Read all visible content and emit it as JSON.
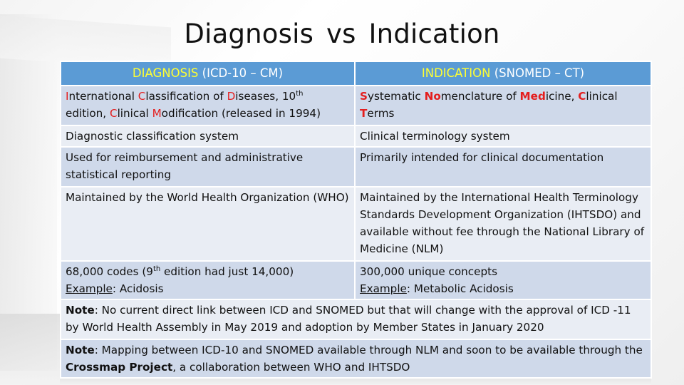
{
  "title": "Diagnosis  vs  Indication",
  "table": {
    "headers": [
      {
        "highlight": "DIAGNOSIS",
        "rest": " (ICD-10 – CM)"
      },
      {
        "highlight": "INDICATION",
        "rest": " (SNOMED – CT)"
      }
    ],
    "row1": {
      "left": {
        "i_letter": "I",
        "i_rest": "nternational ",
        "c_letter": "C",
        "c_rest": "lassification of ",
        "d_letter": "D",
        "d_rest": "iseases, 10",
        "sup": "th",
        "line2_pre": "edition, ",
        "c2_letter": "C",
        "c2_rest": "linical ",
        "m_letter": "M",
        "m_rest": "odification (released in 1994)"
      },
      "right": {
        "s_letter": "S",
        "s_rest": "ystematic ",
        "no_letters": "No",
        "no_rest": "menclature of ",
        "med_letters": "Med",
        "med_rest": "icine, ",
        "c_letter": "C",
        "c_rest": "linical",
        "t_letter": "T",
        "t_rest": "erms"
      }
    },
    "row2": {
      "left": "Diagnostic classification system",
      "right": "Clinical terminology system"
    },
    "row3": {
      "left": "Used for reimbursement and administrative statistical reporting",
      "right": "Primarily intended for clinical documentation"
    },
    "row4": {
      "left": "Maintained by the World Health Organization (WHO)",
      "right": "Maintained by the International Health Terminology Standards Development Organization (IHTSDO) and available without fee through the National Library of Medicine (NLM)"
    },
    "row5": {
      "left_pre": "68,000 codes (9",
      "left_sup": "th",
      "left_post": " edition had just 14,000)",
      "left_example_label": "Example",
      "left_example_value": ": Acidosis",
      "right_line1": "300,000 unique concepts",
      "right_example_label": "Example",
      "right_example_value": ": Metabolic Acidosis"
    },
    "note1": {
      "label": "Note",
      "text": ": No current direct link between ICD and SNOMED but that will change with the approval of ICD -11 by World Health Assembly in May 2019 and adoption by Member States in January 2020"
    },
    "note2": {
      "label": "Note",
      "text_pre": ": Mapping between ICD-10 and SNOMED available through NLM and soon to be available through the ",
      "bold": "Crossmap Project",
      "text_post": ", a collaboration between WHO and IHTSDO"
    }
  }
}
